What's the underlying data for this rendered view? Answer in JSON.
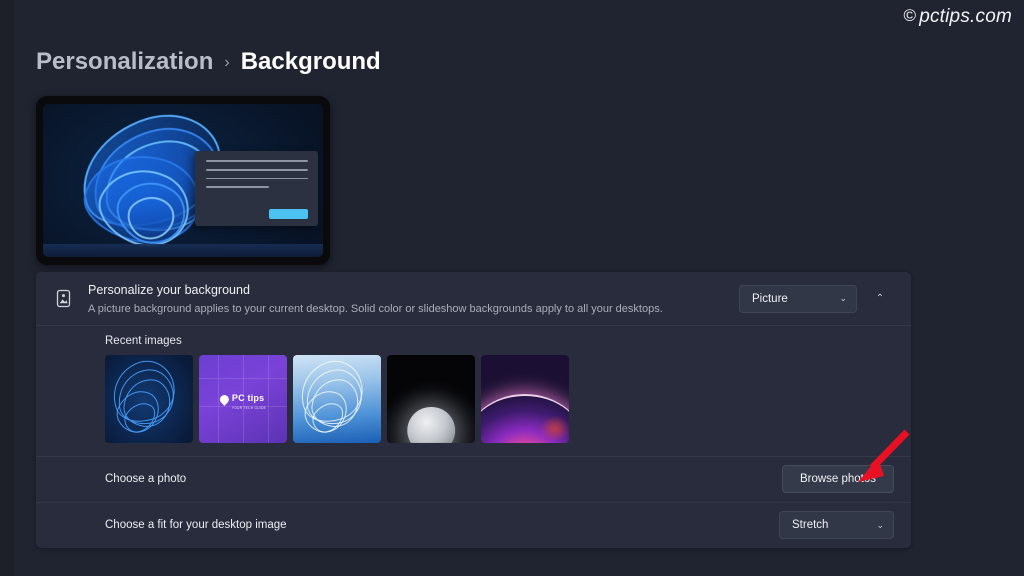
{
  "watermark": {
    "symbol": "©",
    "text": "pctips.com"
  },
  "breadcrumb": {
    "parent": "Personalization",
    "separator": "›",
    "current": "Background"
  },
  "preview": {
    "name": "desktop-preview",
    "wallpaper": "Windows 11 blue bloom"
  },
  "card": {
    "header": {
      "icon": "picture-icon",
      "title": "Personalize your background",
      "subtitle": "A picture background applies to your current desktop. Solid color or slideshow backgrounds apply to all your desktops.",
      "dropdown_value": "Picture",
      "dropdown_chevron": "⌄",
      "collapse_chevron": "⌃"
    },
    "recent": {
      "label": "Recent images",
      "thumbnails": [
        {
          "name": "thumbnail-bloom-dark",
          "alt": "Windows 11 dark blue bloom"
        },
        {
          "name": "thumbnail-pctips-purple",
          "logo_name": "PC tips",
          "logo_tagline": "YOUR TECH GUIDE"
        },
        {
          "name": "thumbnail-bloom-light",
          "alt": "Windows 11 light blue bloom"
        },
        {
          "name": "thumbnail-moon",
          "alt": "Glowing moon on black"
        },
        {
          "name": "thumbnail-magenta-arc",
          "alt": "Purple magenta arc"
        }
      ]
    },
    "choose_photo": {
      "label": "Choose a photo",
      "button_label": "Browse photos"
    },
    "choose_fit": {
      "label": "Choose a fit for your desktop image",
      "dropdown_value": "Stretch",
      "dropdown_chevron": "⌄"
    }
  },
  "annotation": {
    "name": "red-arrow",
    "color": "#e81123",
    "points_to": "Browse photos"
  },
  "colors": {
    "page_background": "#202430",
    "card_background": "#282c3c",
    "control_background": "#323747",
    "accent_blue": "#4cc2f1",
    "text_primary": "#f0f1f4",
    "text_secondary": "#a9aeba"
  }
}
